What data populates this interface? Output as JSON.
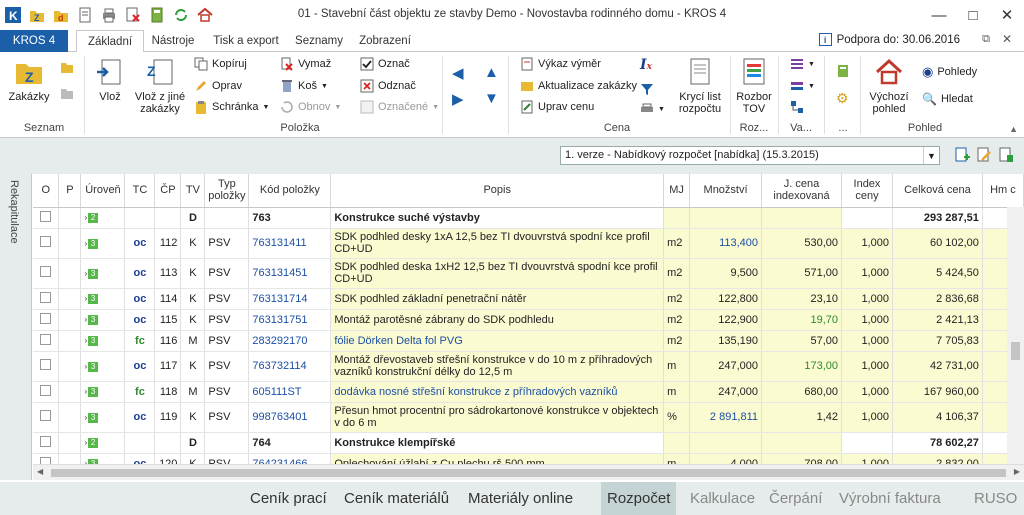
{
  "titlebar": {
    "title": "01 - Stavební část objektu ze stavby Demo - Novostavba rodinného domu - KROS 4"
  },
  "ribbon_tabs": {
    "file": "KROS 4",
    "tabs": [
      "Základní",
      "Nástroje",
      "Tisk a export",
      "Seznamy",
      "Zobrazení"
    ],
    "support": "Podpora do: 30.06.2016"
  },
  "ribbon": {
    "zakazky": "Zakázky",
    "seznam": "Seznam",
    "vloz": "Vlož",
    "vloz_jine": "Vlož z jiné zakázky",
    "kopiruj": "Kopíruj",
    "oprav": "Oprav",
    "schranka": "Schránka",
    "vymaz": "Vymaž",
    "kos": "Koš",
    "obnov": "Obnov",
    "oznac": "Označ",
    "odznac": "Odznač",
    "oznacene": "Označené",
    "polozka": "Položka",
    "vykaz": "Výkaz výměr",
    "aktualizace": "Aktualizace zakázky",
    "uprav_cenu": "Uprav cenu",
    "kryci_list": "Krycí list rozpočtu",
    "rozbor": "Rozbor TOV",
    "cena": "Cena",
    "roz": "Roz...",
    "va": "Va...",
    "dots": "...",
    "vychozi": "Výchozí pohled",
    "pohledy": "Pohledy",
    "hledat": "Hledat",
    "pohled": "Pohled"
  },
  "version_select": "1. verze - Nabídkový rozpočet [nabídka] (15.3.2015)",
  "sidebar_label": "Rekapitulace",
  "columns": [
    "O",
    "P",
    "Úroveň",
    "TC",
    "ČP",
    "TV",
    "Typ položky",
    "Kód položky",
    "Popis",
    "MJ",
    "Množství",
    "J. cena indexovaná",
    "Index ceny",
    "Celková cena",
    "Hm c"
  ],
  "rows": [
    {
      "kind": "section",
      "lvl": "2",
      "tv": "D",
      "kod": "763",
      "popis": "Konstrukce suché výstavby",
      "celkova": "293 287,51"
    },
    {
      "kind": "item",
      "lvl": "3",
      "tc": "oc",
      "cp": "112",
      "tv": "K",
      "typ": "PSV",
      "kod": "763131411",
      "popis": "SDK podhled desky 1xA 12,5 bez TI dvouvrstvá spodní kce profil CD+UD",
      "mj": "m2",
      "mnozstvi": "113,400",
      "mnoz_color": "blue",
      "jcena": "530,00",
      "jc_color": "",
      "index": "1,000",
      "celkova": "60 102,00"
    },
    {
      "kind": "item",
      "lvl": "3",
      "tc": "oc",
      "cp": "113",
      "tv": "K",
      "typ": "PSV",
      "kod": "763131451",
      "popis": "SDK podhled deska 1xH2 12,5 bez TI dvouvrstvá spodní kce profil CD+UD",
      "mj": "m2",
      "mnozstvi": "9,500",
      "mnoz_color": "",
      "jcena": "571,00",
      "jc_color": "",
      "index": "1,000",
      "celkova": "5 424,50"
    },
    {
      "kind": "item",
      "lvl": "3",
      "tc": "oc",
      "cp": "114",
      "tv": "K",
      "typ": "PSV",
      "kod": "763131714",
      "popis": "SDK podhled základní penetrační nátěr",
      "mj": "m2",
      "mnozstvi": "122,800",
      "mnoz_color": "",
      "jcena": "23,10",
      "jc_color": "",
      "index": "1,000",
      "celkova": "2 836,68"
    },
    {
      "kind": "item",
      "lvl": "3",
      "tc": "oc",
      "cp": "115",
      "tv": "K",
      "typ": "PSV",
      "kod": "763131751",
      "popis": "Montáž parotěsné zábrany do SDK podhledu",
      "mj": "m2",
      "mnozstvi": "122,900",
      "mnoz_color": "",
      "jcena": "19,70",
      "jc_color": "green",
      "index": "1,000",
      "celkova": "2 421,13"
    },
    {
      "kind": "item",
      "lvl": "3",
      "tc": "fc",
      "cp": "116",
      "tv": "M",
      "typ": "PSV",
      "kod": "283292170",
      "popis": "fólie Dörken Delta fol PVG",
      "popis_blue": true,
      "mj": "m2",
      "mnozstvi": "135,190",
      "mnoz_color": "",
      "jcena": "57,00",
      "jc_color": "",
      "index": "1,000",
      "celkova": "7 705,83"
    },
    {
      "kind": "item",
      "lvl": "3",
      "tc": "oc",
      "cp": "117",
      "tv": "K",
      "typ": "PSV",
      "kod": "763732114",
      "popis": "Montáž dřevostaveb střešní konstrukce v do 10 m z příhradových vazníků konstrukční délky do 12,5 m",
      "mj": "m",
      "mnozstvi": "247,000",
      "mnoz_color": "",
      "jcena": "173,00",
      "jc_color": "green",
      "index": "1,000",
      "celkova": "42 731,00"
    },
    {
      "kind": "item",
      "lvl": "3",
      "tc": "fc",
      "cp": "118",
      "tv": "M",
      "typ": "PSV",
      "kod": "605111ST",
      "popis": "dodávka nosné střešní konstrukce z příhradových vazníků",
      "popis_blue": true,
      "mj": "m",
      "mnozstvi": "247,000",
      "mnoz_color": "",
      "jcena": "680,00",
      "jc_color": "",
      "index": "1,000",
      "celkova": "167 960,00"
    },
    {
      "kind": "item",
      "lvl": "3",
      "tc": "oc",
      "cp": "119",
      "tv": "K",
      "typ": "PSV",
      "kod": "998763401",
      "popis": "Přesun hmot procentní pro sádrokartonové konstrukce v objektech v do 6 m",
      "mj": "%",
      "mnozstvi": "2 891,811",
      "mnoz_color": "blue",
      "jcena": "1,42",
      "jc_color": "",
      "index": "1,000",
      "celkova": "4 106,37"
    },
    {
      "kind": "section",
      "lvl": "2",
      "tv": "D",
      "kod": "764",
      "popis": "Konstrukce klempířské",
      "celkova": "78 602,27"
    },
    {
      "kind": "item",
      "lvl": "3",
      "tc": "oc",
      "cp": "120",
      "tv": "K",
      "typ": "PSV",
      "kod": "764231466",
      "popis": "Oplechování úžlabí z Cu plechu rš 500 mm",
      "mj": "m",
      "mnozstvi": "4,000",
      "mnoz_color": "",
      "jcena": "708,00",
      "jc_color": "",
      "index": "1,000",
      "celkova": "2 832,00"
    },
    {
      "kind": "item",
      "lvl": "3",
      "tc": "",
      "cp": "",
      "tv": "",
      "typ": "",
      "kod": "",
      "popis": "",
      "mj": "",
      "mnozstvi": "",
      "mnoz_color": "",
      "jcena": "",
      "jc_color": "",
      "index": "",
      "celkova": ""
    }
  ],
  "bottom_tabs": [
    "Ceník prací",
    "Ceník materiálů",
    "Materiály online",
    "Rozpočet",
    "Kalkulace",
    "Čerpání",
    "Výrobní faktura",
    "RUSO"
  ]
}
